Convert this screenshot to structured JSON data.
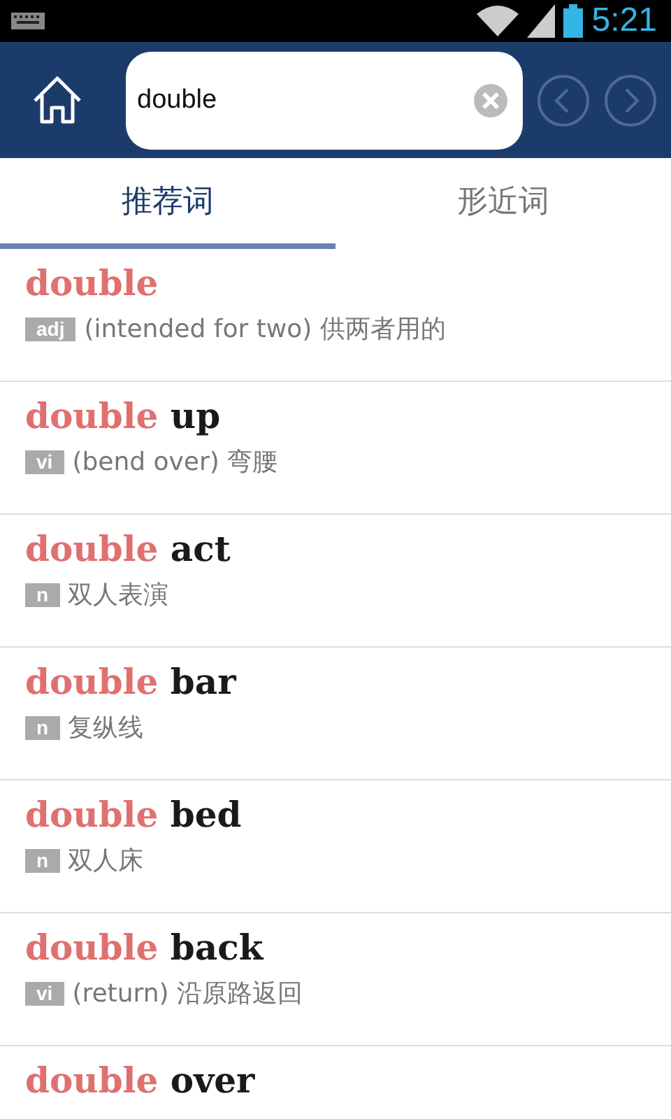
{
  "status_bar": {
    "time": "5:21"
  },
  "search": {
    "value": "double"
  },
  "tabs": [
    {
      "label": "推荐词",
      "selected": true
    },
    {
      "label": "形近词",
      "selected": false
    }
  ],
  "entries": [
    {
      "match": "double",
      "pos": "adj",
      "gloss": "(intended for two) 供两者用的"
    },
    {
      "match": "double",
      "rest": "up",
      "pos": "vi",
      "gloss": "(bend over) 弯腰"
    },
    {
      "match": "double",
      "rest": "act",
      "pos": "n",
      "gloss": "双人表演"
    },
    {
      "match": "double",
      "rest": "bar",
      "pos": "n",
      "gloss": "复纵线"
    },
    {
      "match": "double",
      "rest": "bed",
      "pos": "n",
      "gloss": "双人床"
    },
    {
      "match": "double",
      "rest": "back",
      "pos": "vi",
      "gloss": "(return) 沿原路返回"
    },
    {
      "match": "double",
      "rest": "over"
    }
  ]
}
